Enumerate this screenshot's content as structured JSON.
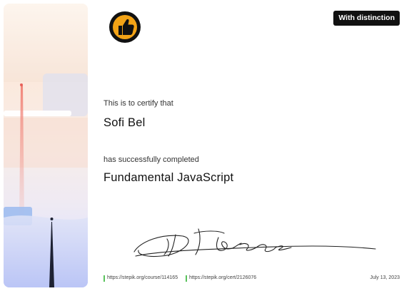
{
  "badge": {
    "label": "With distinction",
    "icon": "thumbs-up-icon"
  },
  "certificate": {
    "intro": "This is to certify that",
    "recipient": "Sofi Bel",
    "completion_text": "has successfully completed",
    "course_title": "Fundamental JavaScript"
  },
  "footer": {
    "course_link": "https://stepik.org/course/114165",
    "cert_link": "https://stepik.org/cert/2126076",
    "date": "July 13, 2023"
  },
  "colors": {
    "badge_bg": "#111111",
    "badge_text": "#ffffff",
    "link_marker": "#59c25c",
    "icon_ring": "#f3a316"
  }
}
